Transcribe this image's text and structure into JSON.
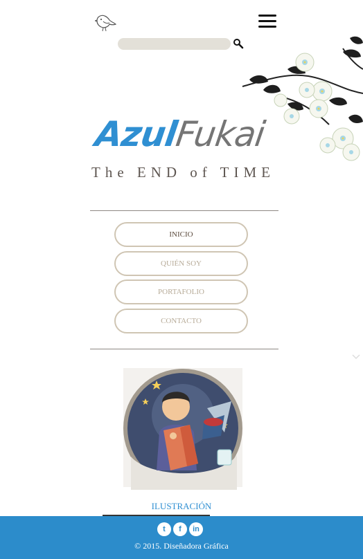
{
  "header": {
    "bird_icon": "bird-outline-icon",
    "menu_icon": "hamburger-menu-icon"
  },
  "search": {
    "placeholder": "",
    "value": "",
    "icon": "magnifier-icon"
  },
  "logo": {
    "part1": "Azul",
    "part2": "Fukai",
    "tagline": "The END of TIME",
    "colors": {
      "azul": "#2f8fd2",
      "fukai": "#757575"
    }
  },
  "nav": {
    "items": [
      {
        "label": "INICIO",
        "active": true
      },
      {
        "label": "QUIÉN SOY",
        "active": false
      },
      {
        "label": "PORTAFOLIO",
        "active": false
      },
      {
        "label": "CONTACTO",
        "active": false
      }
    ]
  },
  "portfolio": {
    "label": "ILUSTRACIÓN"
  },
  "footer": {
    "socials": [
      {
        "name": "twitter-icon",
        "glyph": "t"
      },
      {
        "name": "facebook-icon",
        "glyph": "f"
      },
      {
        "name": "linkedin-icon",
        "glyph": "in"
      }
    ],
    "copyright": "© 2015. Diseñadora Gráfica",
    "background": "#2c8ccb"
  }
}
